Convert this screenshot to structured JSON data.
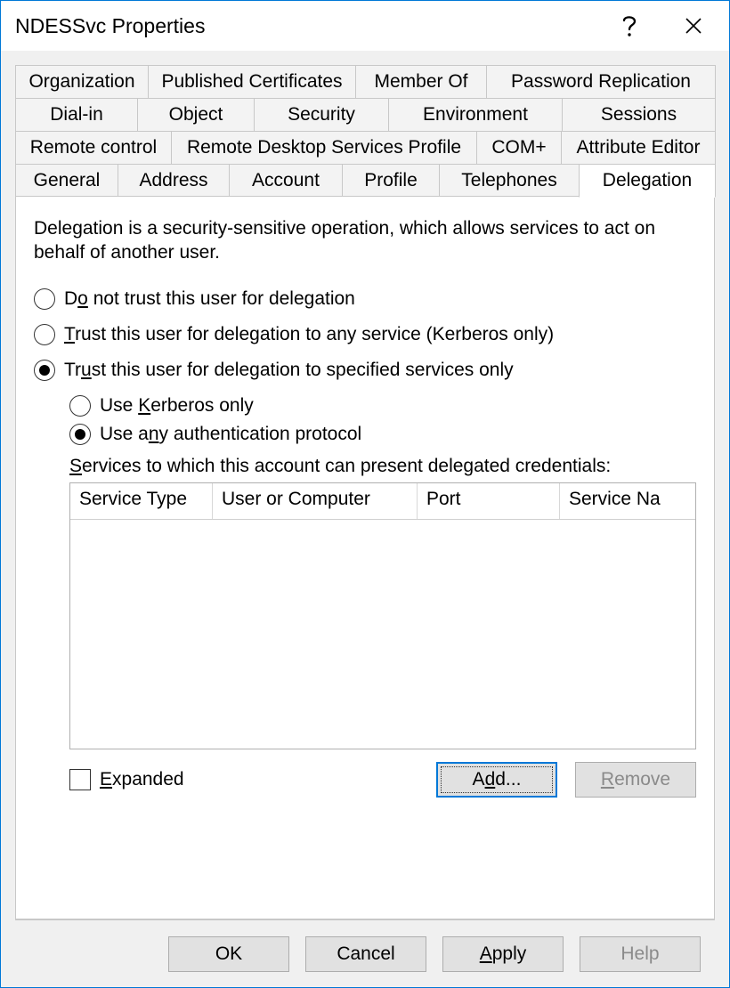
{
  "title": "NDESSvc Properties",
  "tabs": {
    "row1": [
      "Organization",
      "Published Certificates",
      "Member Of",
      "Password Replication"
    ],
    "row2": [
      "Dial-in",
      "Object",
      "Security",
      "Environment",
      "Sessions"
    ],
    "row3": [
      "Remote control",
      "Remote Desktop Services Profile",
      "COM+",
      "Attribute Editor"
    ],
    "row4": [
      "General",
      "Address",
      "Account",
      "Profile",
      "Telephones",
      "Delegation"
    ]
  },
  "delegation": {
    "description": "Delegation is a security-sensitive operation, which allows services to act on behalf of another user.",
    "radio_no_trust_pre": "D",
    "radio_no_trust_ul": "o",
    "radio_no_trust_post": " not trust this user for delegation",
    "radio_any_pre": "",
    "radio_any_ul": "T",
    "radio_any_post": "rust this user for delegation to any service (Kerberos only)",
    "radio_spec_pre": "Tr",
    "radio_spec_ul": "u",
    "radio_spec_post": "st this user for delegation to specified services only",
    "sub_kerb_pre": "Use ",
    "sub_kerb_ul": "K",
    "sub_kerb_post": "erberos only",
    "sub_any_pre": "Use a",
    "sub_any_ul": "n",
    "sub_any_post": "y authentication protocol",
    "list_label_ul": "S",
    "list_label_post": "ervices to which this account can present delegated credentials:",
    "columns": [
      "Service Type",
      "User or Computer",
      "Port",
      "Service Na"
    ],
    "expanded_ul": "E",
    "expanded_post": "xpanded",
    "add_pre": "A",
    "add_ul": "d",
    "add_post": "d...",
    "remove_ul": "R",
    "remove_post": "emove"
  },
  "buttons": {
    "ok": "OK",
    "cancel": "Cancel",
    "apply_ul": "A",
    "apply_post": "pply",
    "help": "Help"
  }
}
